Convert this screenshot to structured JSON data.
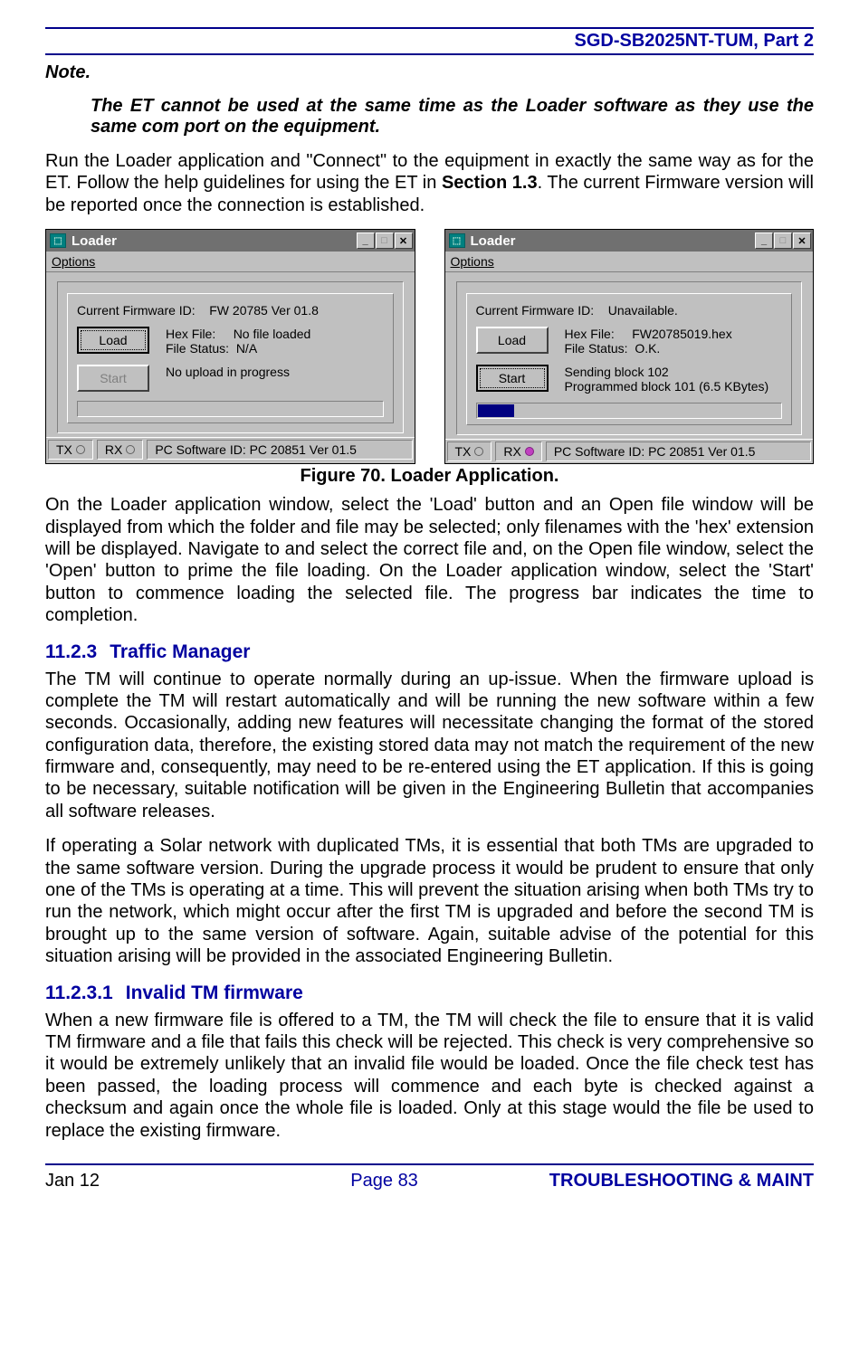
{
  "header": {
    "doc_id": "SGD-SB2025NT-TUM, Part 2"
  },
  "note": {
    "label": "Note.",
    "body": "The ET cannot be used at the same time as the Loader software as they use the same com port on the equipment."
  },
  "para_intro_pre": "Run the Loader application and \"Connect\" to the equipment in exactly the same way as for the ET. Follow the help guidelines for using the ET in ",
  "para_intro_bold": "Section 1.3",
  "para_intro_post": ".  The current Firmware version will be reported once the connection is established.",
  "loader": {
    "title": "Loader",
    "menu": "Options",
    "fw_label": "Current Firmware ID:",
    "hex_label": "Hex File:",
    "status_label": "File Status:",
    "load_btn": "Load",
    "start_btn": "Start",
    "tx": "TX",
    "rx": "RX",
    "pcid": "PC Software ID: PC 20851  Ver 01.5",
    "left": {
      "fw_value": "FW 20785 Ver 01.8",
      "hex_value": "No file loaded",
      "status_value": "N/A",
      "progress_text": "No upload in progress",
      "progress_pct": 0,
      "rx_on": false
    },
    "right": {
      "fw_value": "Unavailable.",
      "hex_value": "FW20785019.hex",
      "status_value": "O.K.",
      "progress_line1": "Sending block 102",
      "progress_line2": "Programmed block 101 (6.5 KBytes)",
      "progress_pct": 12,
      "rx_on": true
    }
  },
  "fig_caption": "Figure 70.  Loader Application.",
  "para_loader": "On the Loader application window, select the 'Load' button and an Open file window will be displayed from which the folder and file may be selected; only filenames with the 'hex' extension will be displayed.  Navigate to and select the correct file and, on the Open file window, select the 'Open' button to prime the file loading.  On the Loader application window, select the 'Start' button to commence loading the selected file.  The progress bar indicates the time to completion.",
  "sec_1123": {
    "num": "11.2.3",
    "title": "Traffic Manager"
  },
  "para_tm1": "The TM will continue to operate normally during an up-issue.  When the firmware upload is complete the TM will restart automatically and will be running the new software within a few seconds.  Occasionally, adding new features will necessitate changing the format of the stored configuration data, therefore, the existing stored data may not match the requirement of the new firmware and, consequently, may need to be re-entered using the ET application.  If this is going to be necessary, suitable notification will be given in the Engineering Bulletin that accompanies all software releases.",
  "para_tm2": "If operating a Solar network with duplicated TMs, it is essential that both TMs are upgraded to the same software version.  During the upgrade process it would be prudent to ensure that only one of the TMs is operating at a time.  This will prevent the situation arising when both TMs try to run the network, which might occur after the first TM is upgraded and before the second TM is brought up to the same version of software.  Again, suitable advise of the potential for this situation arising will be provided in the associated Engineering Bulletin.",
  "sec_11231": {
    "num": "11.2.3.1",
    "title": "Invalid TM firmware"
  },
  "para_inv": "When a new firmware file is offered to a TM, the TM will check the file to ensure that it is valid TM firmware and a file that fails this check will be rejected.  This check is very comprehensive so it would be extremely unlikely that an invalid file would be loaded.  Once the file check test has been passed, the loading process will commence and each byte is checked against a checksum and again once the whole file is loaded.  Only at this stage would the file be used to replace the existing firmware.",
  "footer": {
    "left": "Jan 12",
    "center": "Page 83",
    "right": "TROUBLESHOOTING & MAINT"
  }
}
